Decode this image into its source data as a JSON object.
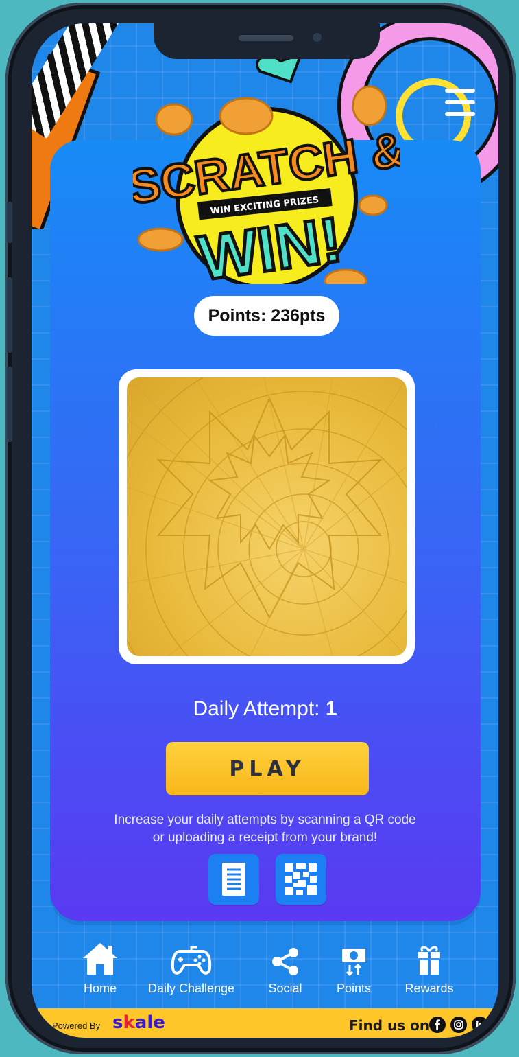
{
  "header": {
    "menu_icon": "hamburger-icon",
    "logo": {
      "line1": "SCRATCH &",
      "banner": "WIN EXCITING PRIZES",
      "line2": "WIN!"
    }
  },
  "points": {
    "label": "Points: 236pts"
  },
  "scratch_card": {
    "state": "unscratched"
  },
  "attempts": {
    "label": "Daily Attempt: ",
    "value": "1"
  },
  "play_button": {
    "label": "PLAY"
  },
  "hint": {
    "line1": "Increase your daily attempts by scanning a QR code",
    "line2": "or uploading a receipt from your brand!"
  },
  "actions": [
    {
      "icon": "receipt-icon"
    },
    {
      "icon": "qr-code-icon"
    }
  ],
  "nav": [
    {
      "label": "Home",
      "icon": "home-icon"
    },
    {
      "label": "Daily Challenge",
      "icon": "gamepad-icon"
    },
    {
      "label": "Social",
      "icon": "share-icon"
    },
    {
      "label": "Points",
      "icon": "points-icon"
    },
    {
      "label": "Rewards",
      "icon": "gift-icon"
    }
  ],
  "footer": {
    "powered_by": "Powered By",
    "brand_1": "s",
    "brand_k": "k",
    "brand_2": "ale",
    "find_us": "Find us on",
    "social": [
      "facebook-icon",
      "instagram-icon",
      "linkedin-icon"
    ]
  },
  "colors": {
    "background": "#1f86ea",
    "card_top": "#178bf6",
    "card_bottom": "#5a39f2",
    "play": "#ffc62a",
    "footer": "#ffc62a"
  }
}
